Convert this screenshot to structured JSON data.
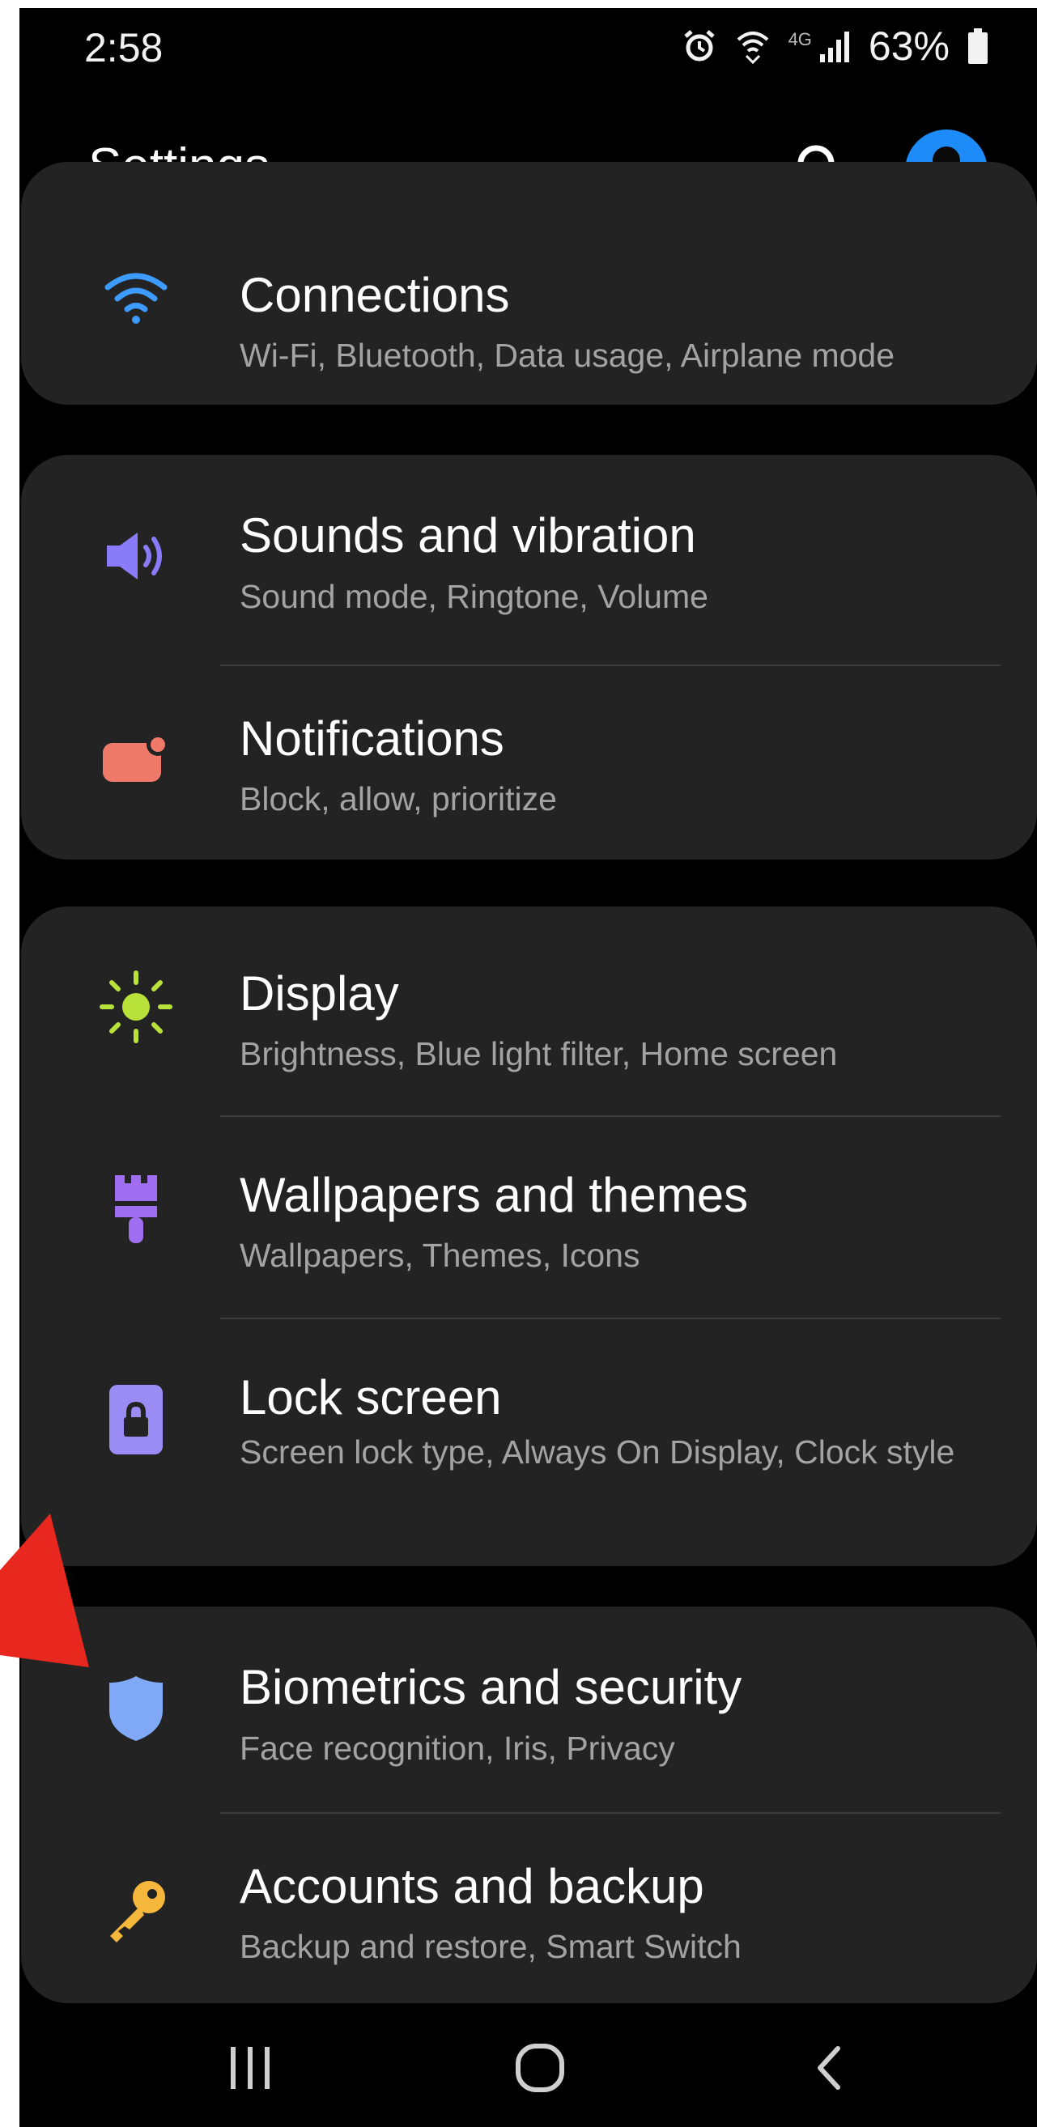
{
  "status_bar": {
    "time": "2:58",
    "network": "4G",
    "battery": "63%",
    "icons": [
      "alarm-icon",
      "wifi-calling-icon",
      "signal-icon",
      "battery-icon"
    ]
  },
  "header": {
    "title": "Settings",
    "icons": [
      "search-icon",
      "account-icon"
    ]
  },
  "settings": [
    {
      "title": "Connections",
      "subtitle": "Wi-Fi, Bluetooth, Data usage, Airplane mode",
      "icon": "wifi-icon"
    },
    {
      "title": "Sounds and vibration",
      "subtitle": "Sound mode, Ringtone, Volume",
      "icon": "speaker-icon"
    },
    {
      "title": "Notifications",
      "subtitle": "Block, allow, prioritize",
      "icon": "notification-icon"
    },
    {
      "title": "Display",
      "subtitle": "Brightness, Blue light filter, Home screen",
      "icon": "sun-icon"
    },
    {
      "title": "Wallpapers and themes",
      "subtitle": "Wallpapers, Themes, Icons",
      "icon": "brush-icon"
    },
    {
      "title": "Lock screen",
      "subtitle": "Screen lock type, Always On Display, Clock style",
      "icon": "lock-icon"
    },
    {
      "title": "Biometrics and security",
      "subtitle": "Face recognition, Iris, Privacy",
      "icon": "shield-icon"
    },
    {
      "title": "Accounts and backup",
      "subtitle": "Backup and restore, Smart Switch",
      "icon": "key-icon"
    }
  ],
  "nav_bar": {
    "icons": [
      "recents-icon",
      "home-icon",
      "back-icon"
    ]
  },
  "colors": {
    "background": "#000000",
    "card": "#232323",
    "title_text": "#ffffff",
    "subtitle_text": "#a3a3a3",
    "wifi": "#3d9bff",
    "speaker": "#8a7cf8",
    "notification": "#f07a6a",
    "sun": "#b8e23a",
    "brush": "#a06ef0",
    "lock": "#9b8cf5",
    "shield": "#7fa9f7",
    "key": "#f5b83d",
    "avatar": "#1d8cf8",
    "annotation_arrow": "#e8271e"
  }
}
